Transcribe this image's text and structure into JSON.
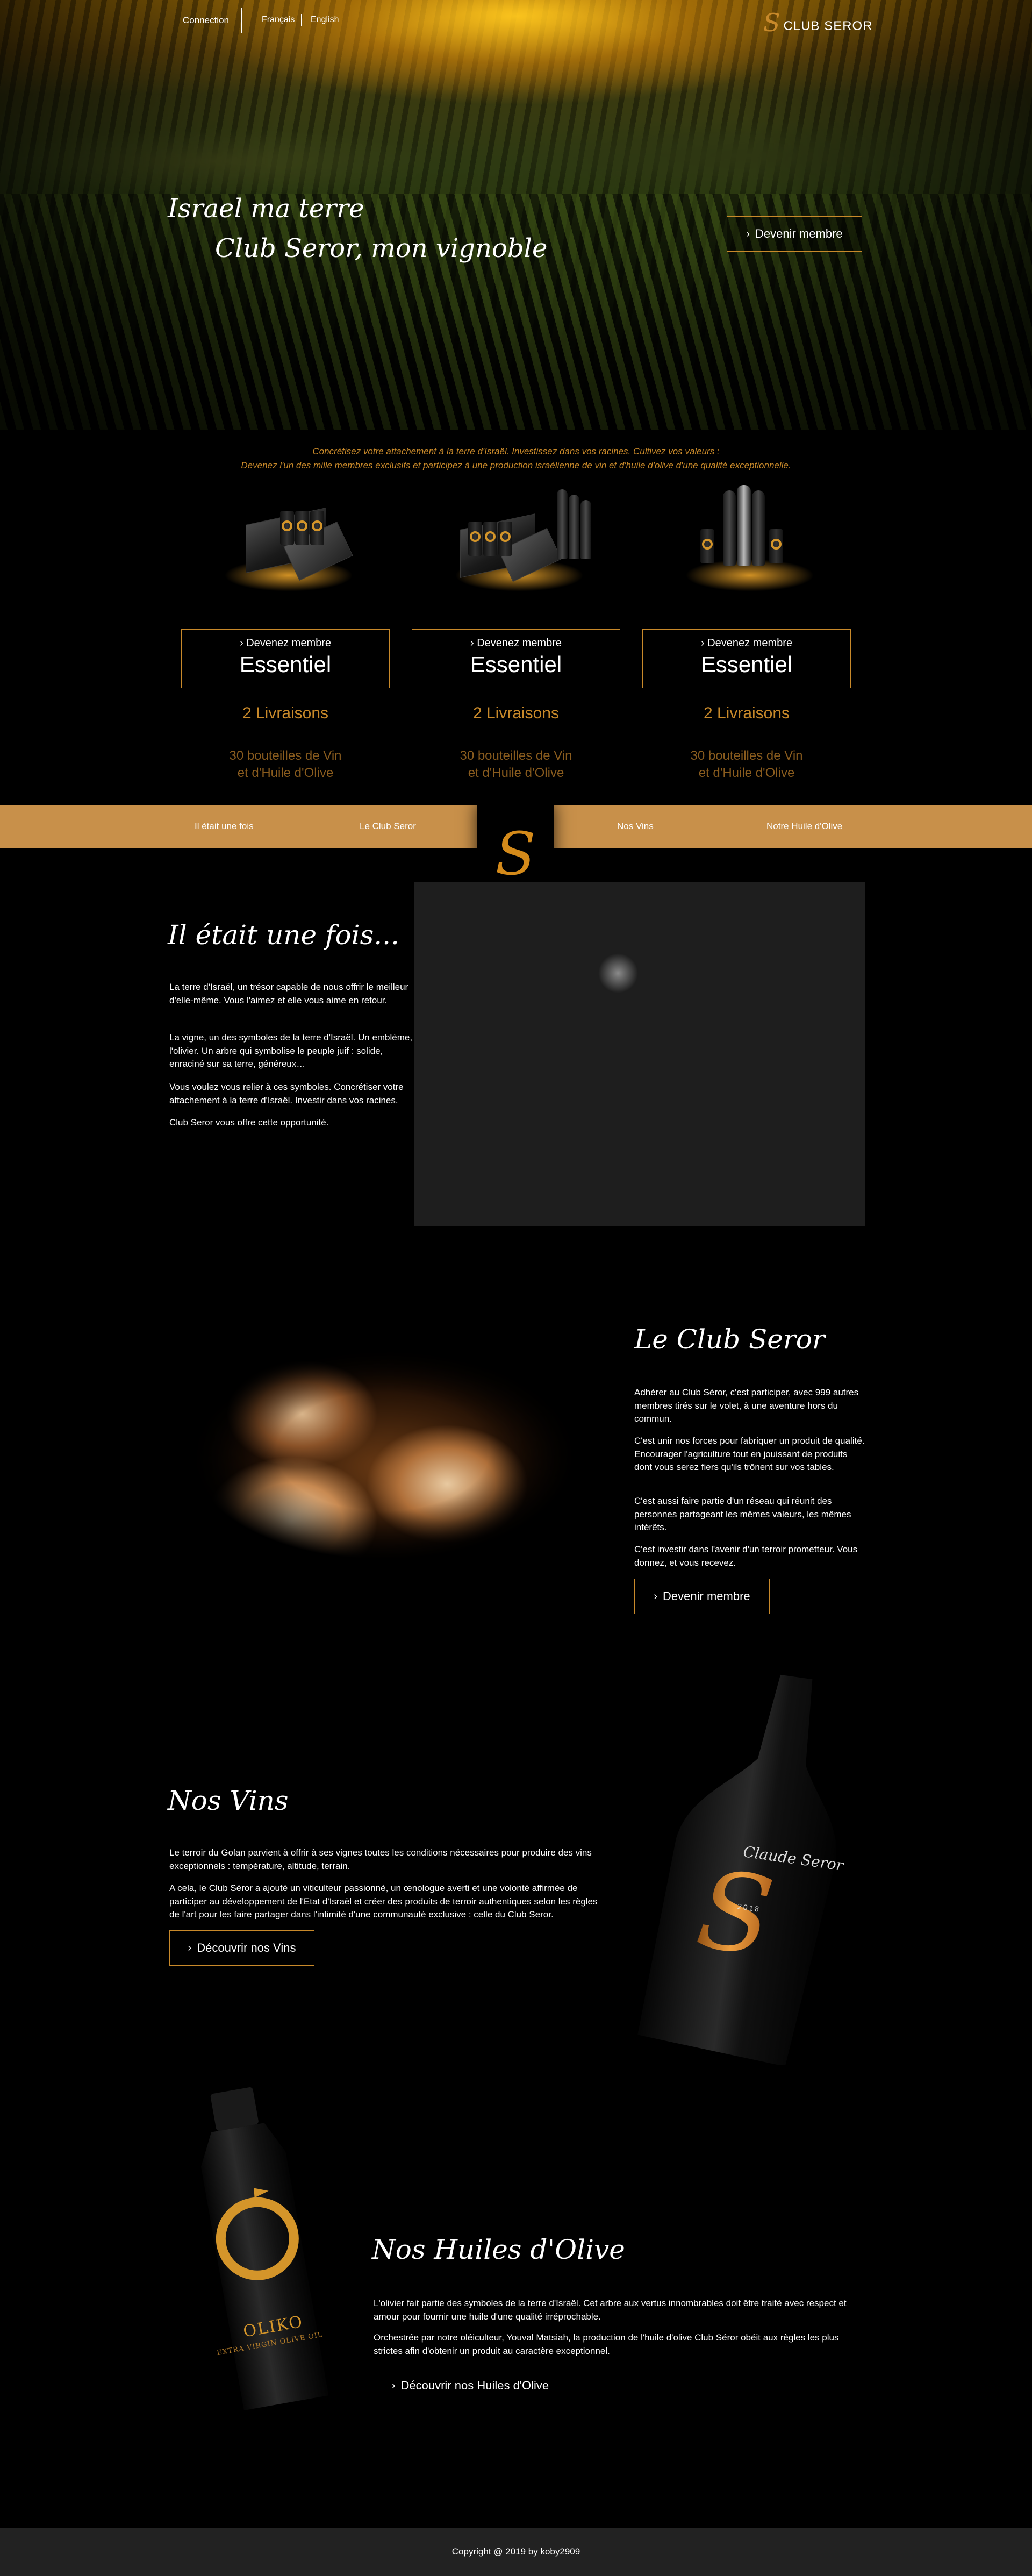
{
  "header": {
    "login_label": "Connection",
    "lang_fr": "Français",
    "lang_en": "English",
    "brand_name": "CLUB SEROR",
    "brand_logo_letter": "S"
  },
  "hero": {
    "title_line1": "Israel ma terre",
    "title_line2": "Club Seror, mon vignoble",
    "cta_label": "Devenir membre",
    "tagline_line1": "Concrétisez votre attachement à la terre d'Israël. Investissez dans vos racines. Cultivez vos valeurs :",
    "tagline_line2": "Devenez l'un des mille membres exclusifs et participez à une production israélienne de vin et d'huile d'olive d'une qualité exceptionnelle."
  },
  "offers": [
    {
      "small_label": "Devenez membre",
      "big_label": "Essentiel",
      "deliveries": "2 Livraisons",
      "desc_line1": "30 bouteilles de Vin",
      "desc_line2": "et d'Huile d'Olive"
    },
    {
      "small_label": "Devenez membre",
      "big_label": "Essentiel",
      "deliveries": "2 Livraisons",
      "desc_line1": "30 bouteilles de Vin",
      "desc_line2": "et d'Huile d'Olive"
    },
    {
      "small_label": "Devenez membre",
      "big_label": "Essentiel",
      "deliveries": "2 Livraisons",
      "desc_line1": "30 bouteilles de Vin",
      "desc_line2": "et d'Huile d'Olive"
    }
  ],
  "nav": {
    "items": [
      "Il était une fois",
      "Le Club Seror",
      "Nos Vins",
      "Notre Huile d'Olive"
    ],
    "logo_letter": "S"
  },
  "section_history": {
    "title": "Il était une fois...",
    "paragraphs": [
      "La terre d'Israël, un trésor capable de nous offrir le meilleur d'elle-même. Vous l'aimez et elle vous aime en retour.",
      "La vigne, un des symboles de la terre d'Israël. Un emblème, l'olivier. Un arbre qui symbolise le peuple juif : solide, enraciné sur sa terre, généreux…",
      "Vous voulez vous relier à ces symboles. Concrétiser votre attachement à la terre d'Israël. Investir dans vos racines.",
      "Club Seror vous offre cette opportunité."
    ]
  },
  "section_club": {
    "title": "Le Club Seror",
    "paragraphs": [
      "Adhérer au Club Séror, c'est participer, avec 999 autres membres tirés sur le volet, à une aventure hors du commun.",
      "C'est unir nos forces pour fabriquer un produit de qualité. Encourager l'agriculture tout en jouissant de produits dont vous serez fiers qu'ils trônent sur vos tables.",
      "C'est aussi faire partie d'un réseau qui réunit des personnes partageant les mêmes valeurs, les mêmes intérêts.",
      "C'est investir dans l'avenir d'un terroir prometteur. Vous donnez, et vous recevez."
    ],
    "cta_label": "Devenir membre"
  },
  "section_wines": {
    "title": "Nos Vins",
    "paragraphs": [
      "Le terroir du Golan parvient à offrir à ses vignes toutes les conditions nécessaires pour produire des vins exceptionnels : température, altitude, terrain.",
      "A cela, le Club Séror a ajouté un viticulteur passionné, un œnologue averti et une volonté affirmée de participer au développement de l'Etat d'Israël et créer des produits de terroir authentiques selon les règles de l'art pour les faire partager dans l'intimité d'une communauté exclusive : celle du Club Seror."
    ],
    "cta_label": "Découvrir nos Vins",
    "bottle_label_script": "Claude Seror",
    "bottle_label_year": "2018"
  },
  "section_oil": {
    "title": "Nos Huiles d'Olive",
    "paragraphs": [
      "L'olivier fait partie des symboles de la terre d'Israël. Cet arbre aux vertus innombrables doit être traité avec respect et amour pour fournir une huile d'une qualité irréprochable.",
      "Orchestrée par notre oléiculteur, Youval Matsiah, la production de l'huile d'olive Club Séror obéit aux règles les plus strictes afin d'obtenir un produit au caractère exceptionnel."
    ],
    "cta_label": "Découvrir nos Huiles d'Olive",
    "bottle_brand": "OLIKO",
    "bottle_sub": "EXTRA VIRGIN OLIVE OIL"
  },
  "footer": {
    "copyright": "Copyright @ 2019 by koby2909"
  },
  "colors": {
    "accent": "#c8892a",
    "nav_bar": "#c8904a",
    "footer_bg": "#222222"
  }
}
